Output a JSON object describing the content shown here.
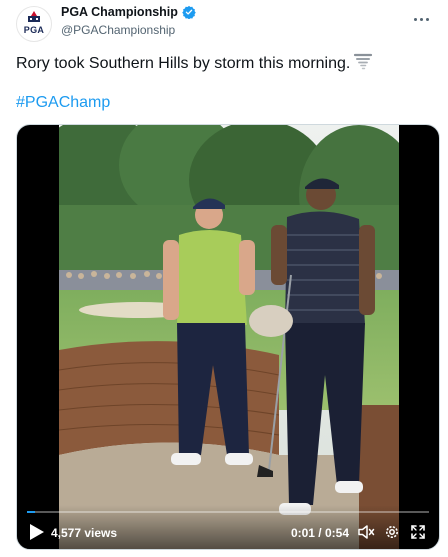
{
  "account": {
    "display_name": "PGA Championship",
    "handle": "@PGAChampionship",
    "avatar_text": "PGA",
    "verified": true
  },
  "tweet": {
    "text": "Rory took Southern Hills by storm this morning.",
    "emoji_icon": "tornado-icon",
    "hashtag": "#PGAChamp"
  },
  "video": {
    "views": "4,577 views",
    "time": "0:01 / 0:54",
    "progress": 0.02
  },
  "colors": {
    "accent": "#1d9bf0",
    "text": "#0f1419",
    "secondary_text": "#536471"
  },
  "icons": {
    "more": "more-icon",
    "play": "play-icon",
    "volume": "volume-icon",
    "settings": "gear-icon",
    "fullscreen": "fullscreen-icon"
  }
}
